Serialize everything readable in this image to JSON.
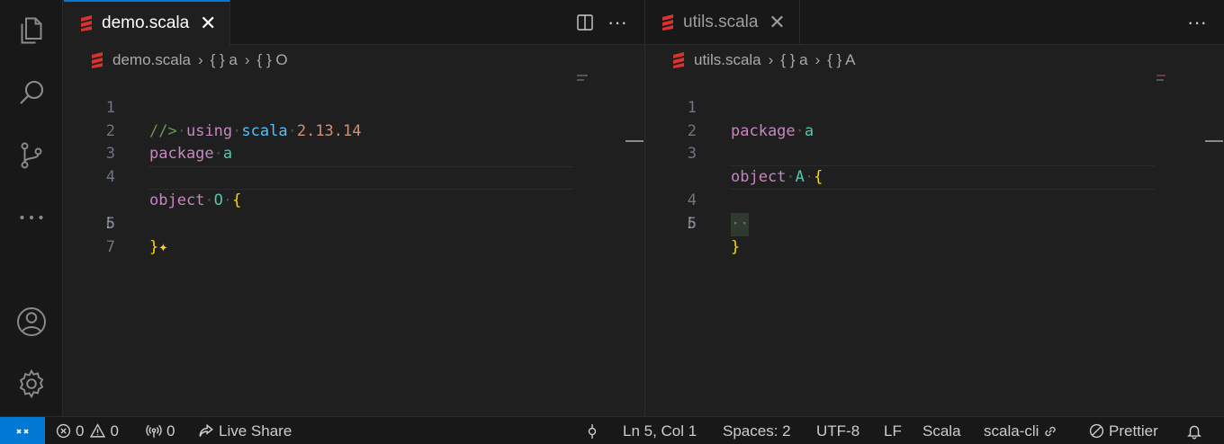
{
  "colors": {
    "accent": "#0078d4",
    "scala_red": "#dc322f",
    "keyword": "#c586c0",
    "identifier": "#4ec9b0",
    "brace": "#ffd700",
    "number": "#ce9178",
    "comment": "#6a9955"
  },
  "activity_bar": {
    "icons": [
      "explorer-icon",
      "search-icon",
      "source-control-icon",
      "more-icon",
      "account-icon",
      "settings-gear-icon"
    ]
  },
  "left_editor": {
    "tab": {
      "label": "demo.scala",
      "close": "✕"
    },
    "actions": {
      "split": "split-editor-icon",
      "more": "···"
    },
    "breadcrumb": {
      "file": "demo.scala",
      "ns1": "{ } a",
      "ns2": "{ } O"
    },
    "lines": [
      {
        "n": "1",
        "comment": "//>",
        "using": "using",
        "dir": "scala",
        "version": "2.13.14"
      },
      {
        "n": "2",
        "kw": "package",
        "id": "a"
      },
      {
        "n": "3"
      },
      {
        "n": "4",
        "kw": "object",
        "id": "O",
        "brace": "{"
      },
      {
        "n": "5"
      },
      {
        "n": "6",
        "brace": "}",
        "sparkle": "✦"
      },
      {
        "n": "7"
      }
    ]
  },
  "right_editor": {
    "tab": {
      "label": "utils.scala",
      "close": "✕"
    },
    "actions": {
      "more": "···"
    },
    "breadcrumb": {
      "file": "utils.scala",
      "ns1": "{ } a",
      "ns2": "{ } A"
    },
    "lines": [
      {
        "n": "1",
        "kw": "package",
        "id": "a"
      },
      {
        "n": "2"
      },
      {
        "n": "3",
        "kw": "object",
        "id": "A",
        "brace": "{"
      },
      {
        "n": "4",
        "indent": "··"
      },
      {
        "n": "5",
        "brace": "}"
      },
      {
        "n": "6"
      }
    ]
  },
  "status_bar": {
    "errors": "0",
    "warnings": "0",
    "ports": "0",
    "live_share": "Live Share",
    "position": "Ln 5, Col 1",
    "spaces": "Spaces: 2",
    "encoding": "UTF-8",
    "eol": "LF",
    "language": "Scala",
    "build": "scala-cli",
    "formatter": "Prettier"
  }
}
